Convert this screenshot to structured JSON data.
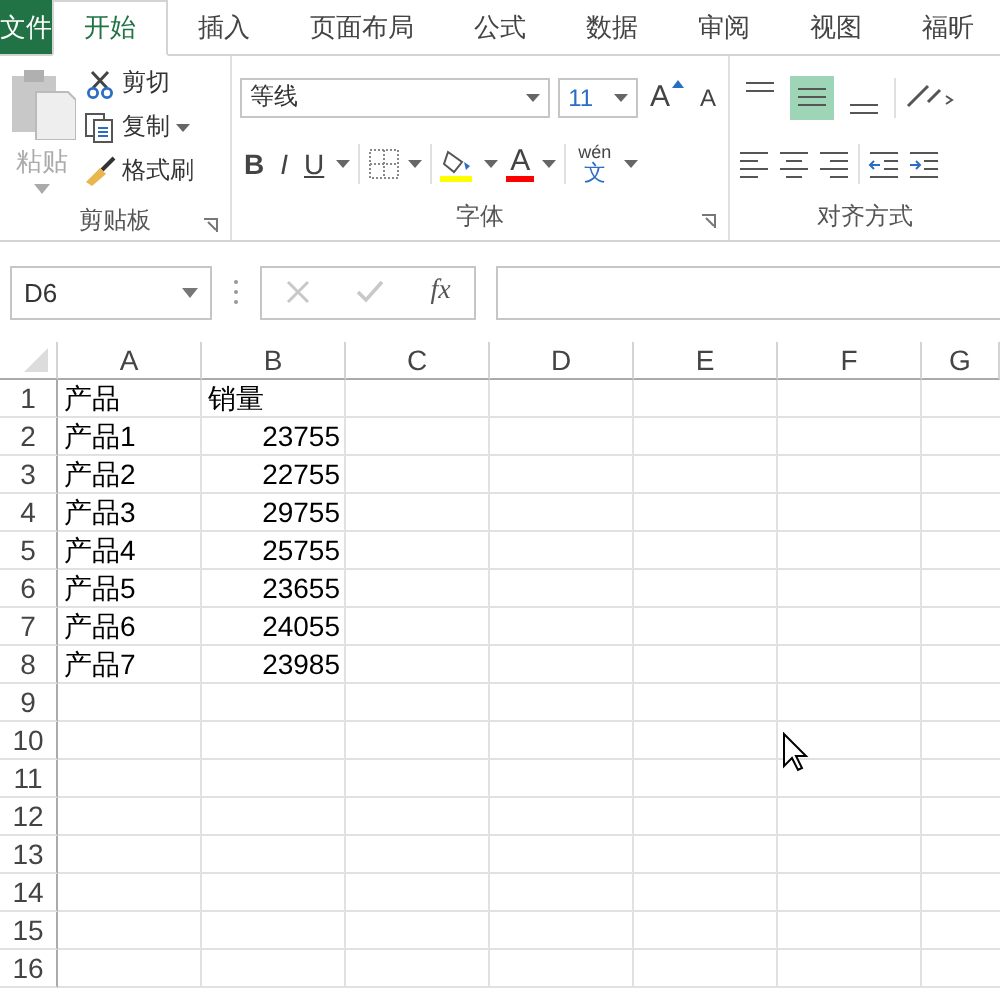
{
  "tabs": [
    {
      "label": "文件",
      "kind": "file",
      "selected": false
    },
    {
      "label": "开始",
      "kind": "tab",
      "selected": true
    },
    {
      "label": "插入",
      "kind": "tab",
      "selected": false
    },
    {
      "label": "页面布局",
      "kind": "tab",
      "selected": false
    },
    {
      "label": "公式",
      "kind": "tab",
      "selected": false
    },
    {
      "label": "数据",
      "kind": "tab",
      "selected": false
    },
    {
      "label": "审阅",
      "kind": "tab",
      "selected": false
    },
    {
      "label": "视图",
      "kind": "tab",
      "selected": false
    },
    {
      "label": "福昕",
      "kind": "tab",
      "selected": false
    }
  ],
  "clipboard": {
    "paste": "粘贴",
    "cut": "剪切",
    "copy": "复制",
    "format_painter": "格式刷",
    "label": "剪贴板"
  },
  "font": {
    "name": "等线",
    "size": "11",
    "grow": "A",
    "shrink": "A",
    "bold": "B",
    "italic": "I",
    "underline": "U",
    "font_color": "A",
    "phonetic_top": "wén",
    "phonetic_bottom": "文",
    "label": "字体"
  },
  "alignment": {
    "label": "对齐方式",
    "vertical": [
      {
        "kind": "top",
        "selected": false
      },
      {
        "kind": "middle",
        "selected": true
      },
      {
        "kind": "bottom",
        "selected": false
      }
    ]
  },
  "name_box": "D6",
  "fx": "fx",
  "columns": [
    "A",
    "B",
    "C",
    "D",
    "E",
    "F",
    "G"
  ],
  "rows": [
    {
      "number": "1",
      "cells": [
        "产品",
        "销量"
      ]
    },
    {
      "number": "2",
      "cells": [
        "产品1",
        "23755"
      ]
    },
    {
      "number": "3",
      "cells": [
        "产品2",
        "22755"
      ]
    },
    {
      "number": "4",
      "cells": [
        "产品3",
        "29755"
      ]
    },
    {
      "number": "5",
      "cells": [
        "产品4",
        "25755"
      ]
    },
    {
      "number": "6",
      "cells": [
        "产品5",
        "23655"
      ]
    },
    {
      "number": "7",
      "cells": [
        "产品6",
        "24055"
      ]
    },
    {
      "number": "8",
      "cells": [
        "产品7",
        "23985"
      ]
    },
    {
      "number": "9"
    },
    {
      "number": "10"
    },
    {
      "number": "11"
    },
    {
      "number": "12"
    },
    {
      "number": "13"
    },
    {
      "number": "14"
    },
    {
      "number": "15"
    },
    {
      "number": "16"
    }
  ]
}
